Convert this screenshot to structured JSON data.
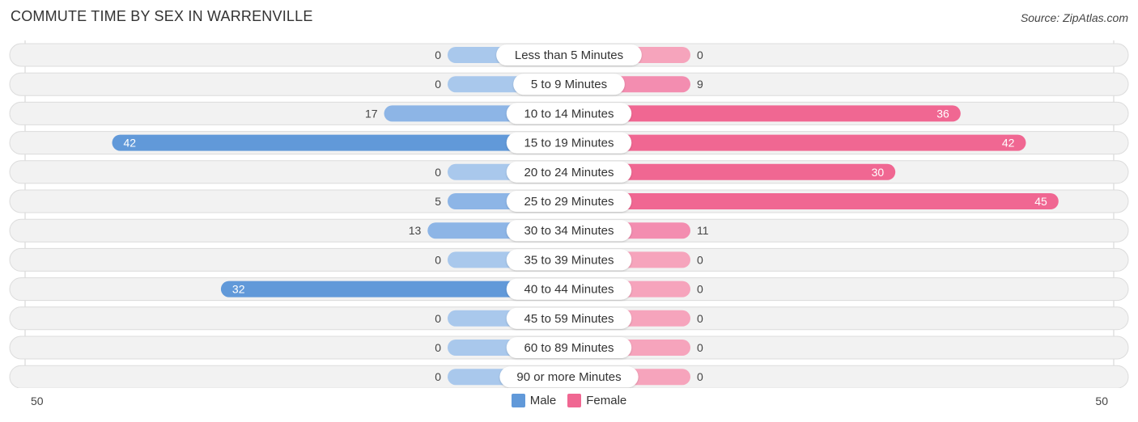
{
  "title": "COMMUTE TIME BY SEX IN WARRENVILLE",
  "source": "Source: ZipAtlas.com",
  "colors": {
    "male": "#6199d9",
    "male_light": "#a9c8ec",
    "female": "#f06792",
    "female_light": "#f6a4bc",
    "track": "#f2f2f2",
    "track_border": "#dcdcdc"
  },
  "legend": [
    {
      "label": "Male",
      "color": "#6199d9"
    },
    {
      "label": "Female",
      "color": "#f06792"
    }
  ],
  "axis": {
    "left_label": "50",
    "right_label": "50"
  },
  "chart_data": {
    "type": "bar",
    "orientation": "horizontal-diverging",
    "title": "COMMUTE TIME BY SEX IN WARRENVILLE",
    "categories": [
      "Less than 5 Minutes",
      "5 to 9 Minutes",
      "10 to 14 Minutes",
      "15 to 19 Minutes",
      "20 to 24 Minutes",
      "25 to 29 Minutes",
      "30 to 34 Minutes",
      "35 to 39 Minutes",
      "40 to 44 Minutes",
      "45 to 59 Minutes",
      "60 to 89 Minutes",
      "90 or more Minutes"
    ],
    "series": [
      {
        "name": "Male",
        "values": [
          0,
          0,
          17,
          42,
          0,
          5,
          13,
          0,
          32,
          0,
          0,
          0
        ]
      },
      {
        "name": "Female",
        "values": [
          0,
          9,
          36,
          42,
          30,
          45,
          11,
          0,
          0,
          0,
          0,
          0
        ]
      }
    ],
    "xlim": [
      -50,
      50
    ],
    "xtick_labels": [
      "50",
      "50"
    ],
    "legend_position": "bottom-center",
    "grid": false
  }
}
